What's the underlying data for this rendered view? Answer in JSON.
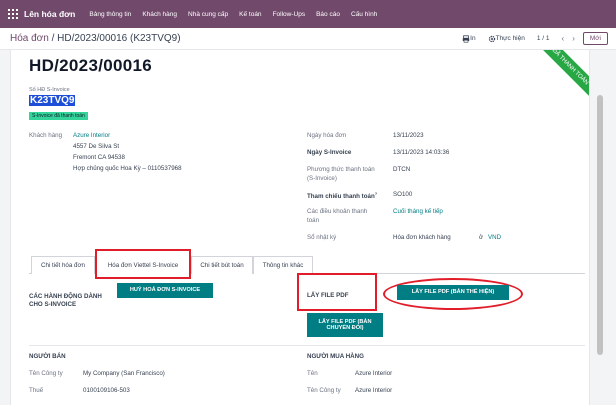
{
  "app": {
    "name": "Lên hóa đơn"
  },
  "menu": [
    "Bảng thông tin",
    "Khách hàng",
    "Nhà cung cấp",
    "Kế toán",
    "Follow-Ups",
    "Báo cáo",
    "Cấu hình"
  ],
  "breadcrumb": {
    "parent": "Hóa đơn",
    "separator": " / ",
    "current": "HD/2023/00016 (K23TVQ9)"
  },
  "control": {
    "print": "In",
    "action": "Thực hiện",
    "pager": "1 / 1",
    "new": "Mới"
  },
  "record": {
    "title": "HD/2023/00016",
    "sinvoice_label": "Số HĐ S-Invoice",
    "sinvoice_code": "K23TVQ9",
    "status_badge": "S-Invoice đã thanh toán",
    "customer_label": "Khách hàng",
    "customer_name": "Azure Interior",
    "address_1": "4557 De Silva St",
    "address_2": "Fremont CA 94538",
    "address_3": "Hợp chủng quốc Hoa Kỳ – 0110537968",
    "invoice_date_label": "Ngày hóa đơn",
    "invoice_date": "13/11/2023",
    "sinvoice_date_label": "Ngày S-Invoice",
    "sinvoice_date": "13/11/2023 14:03:36",
    "payment_method_label_1": "Phương thức thanh toán",
    "payment_method_label_2": "(S-Invoice)",
    "payment_method": "DTCN",
    "payment_ref_label": "Tham chiếu thanh toán",
    "payment_ref_mark": "?",
    "payment_ref": "SO100",
    "terms_label_1": "Các điều khoản thanh",
    "terms_label_2": "toán",
    "terms": "Cuối tháng kế tiếp",
    "journal_label": "Sổ nhật ký",
    "journal": "Hóa đơn khách hàng",
    "journal_in": "ở",
    "currency": "VND"
  },
  "tabs": [
    "Chi tiết hóa đơn",
    "Hóa đơn Viettel S-Invoice",
    "Chi tiết bút toán",
    "Thông tin khác"
  ],
  "sinvoice_tab": {
    "actions_title_1": "CÁC HÀNH ĐỘNG DÀNH",
    "actions_title_2": "CHO S-INVOICE",
    "cancel_button": "HUỶ HOÁ ĐƠN S-INVOICE",
    "pdf_title": "LẤY FILE PDF",
    "pdf_draft_button": "LẤY FILE PDF (BẢN THỂ HIỆN)",
    "pdf_converted_button_1": "LẤY FILE PDF (BẢN",
    "pdf_converted_button_2": "CHUYỂN ĐỔI)",
    "seller_title": "NGƯỜI BÁN",
    "seller_company_label": "Tên Công ty",
    "seller_company": "My Company (San Francisco)",
    "seller_tax_label": "Thuế",
    "seller_tax": "0100109106-503",
    "buyer_title": "NGƯỜI MUA HÀNG",
    "buyer_name_label": "Tên",
    "buyer_name": "Azure Interior",
    "buyer_company_label": "Tên Công ty",
    "buyer_company": "Azure Interior"
  },
  "ribbon": "ĐÃ THANH TOÁN",
  "colors": {
    "brand": "#71496b",
    "accent": "#017e84",
    "annotation": "#e11d2a",
    "status": "#34d399"
  }
}
